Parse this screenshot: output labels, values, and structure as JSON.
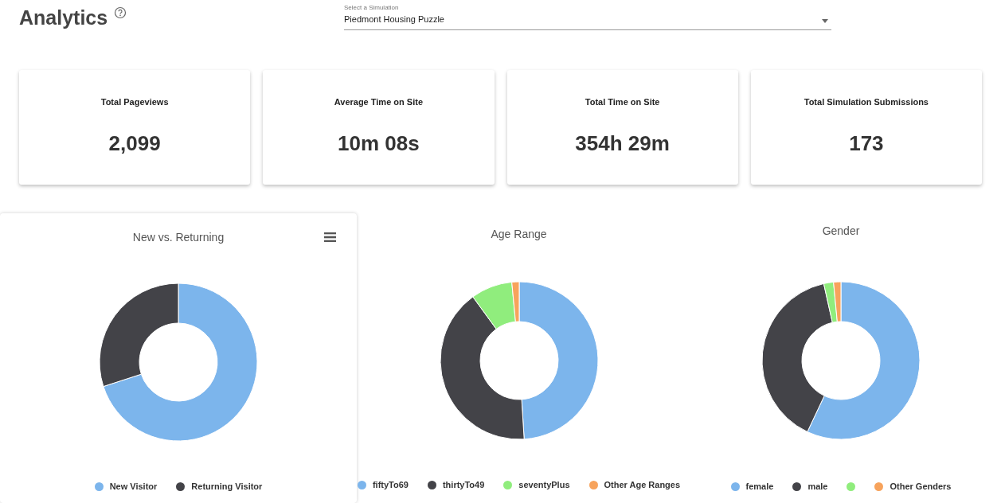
{
  "page": {
    "title": "Analytics"
  },
  "simulation_select": {
    "label": "Select a Simulation",
    "value": "Piedmont Housing Puzzle"
  },
  "stats": [
    {
      "label": "Total Pageviews",
      "value": "2,099"
    },
    {
      "label": "Average Time on Site",
      "value": "10m 08s"
    },
    {
      "label": "Total Time on Site",
      "value": "354h 29m"
    },
    {
      "label": "Total Simulation Submissions",
      "value": "173"
    }
  ],
  "charts": [
    {
      "has_menu": true,
      "chart_data": {
        "type": "donut",
        "title": "New vs. Returning",
        "legend": "bottom",
        "categories": [
          "New Visitor",
          "Returning Visitor"
        ],
        "series": [
          {
            "colors": [
              "#7cb5ec",
              "#434348"
            ],
            "values": [
              0.7,
              0.3
            ]
          }
        ]
      }
    },
    {
      "has_menu": false,
      "chart_data": {
        "type": "donut",
        "title": "Age Range",
        "legend": "bottom",
        "categories": [
          "fiftyTo69",
          "thirtyTo49",
          "seventyPlus",
          "Other Age Ranges"
        ],
        "series": [
          {
            "colors": [
              "#7cb5ec",
              "#434348",
              "#90ed7d",
              "#f7a35c"
            ],
            "values": [
              0.49,
              0.41,
              0.085,
              0.015
            ]
          }
        ]
      }
    },
    {
      "has_menu": false,
      "chart_data": {
        "type": "donut",
        "title": "Gender",
        "legend": "bottom",
        "categories": [
          "female",
          "male",
          null,
          "Other Genders"
        ],
        "series": [
          {
            "colors": [
              "#7cb5ec",
              "#434348",
              "#90ed7d",
              "#f7a35c"
            ],
            "values": [
              0.57,
              0.395,
              0.02,
              0.015
            ]
          }
        ]
      }
    }
  ]
}
